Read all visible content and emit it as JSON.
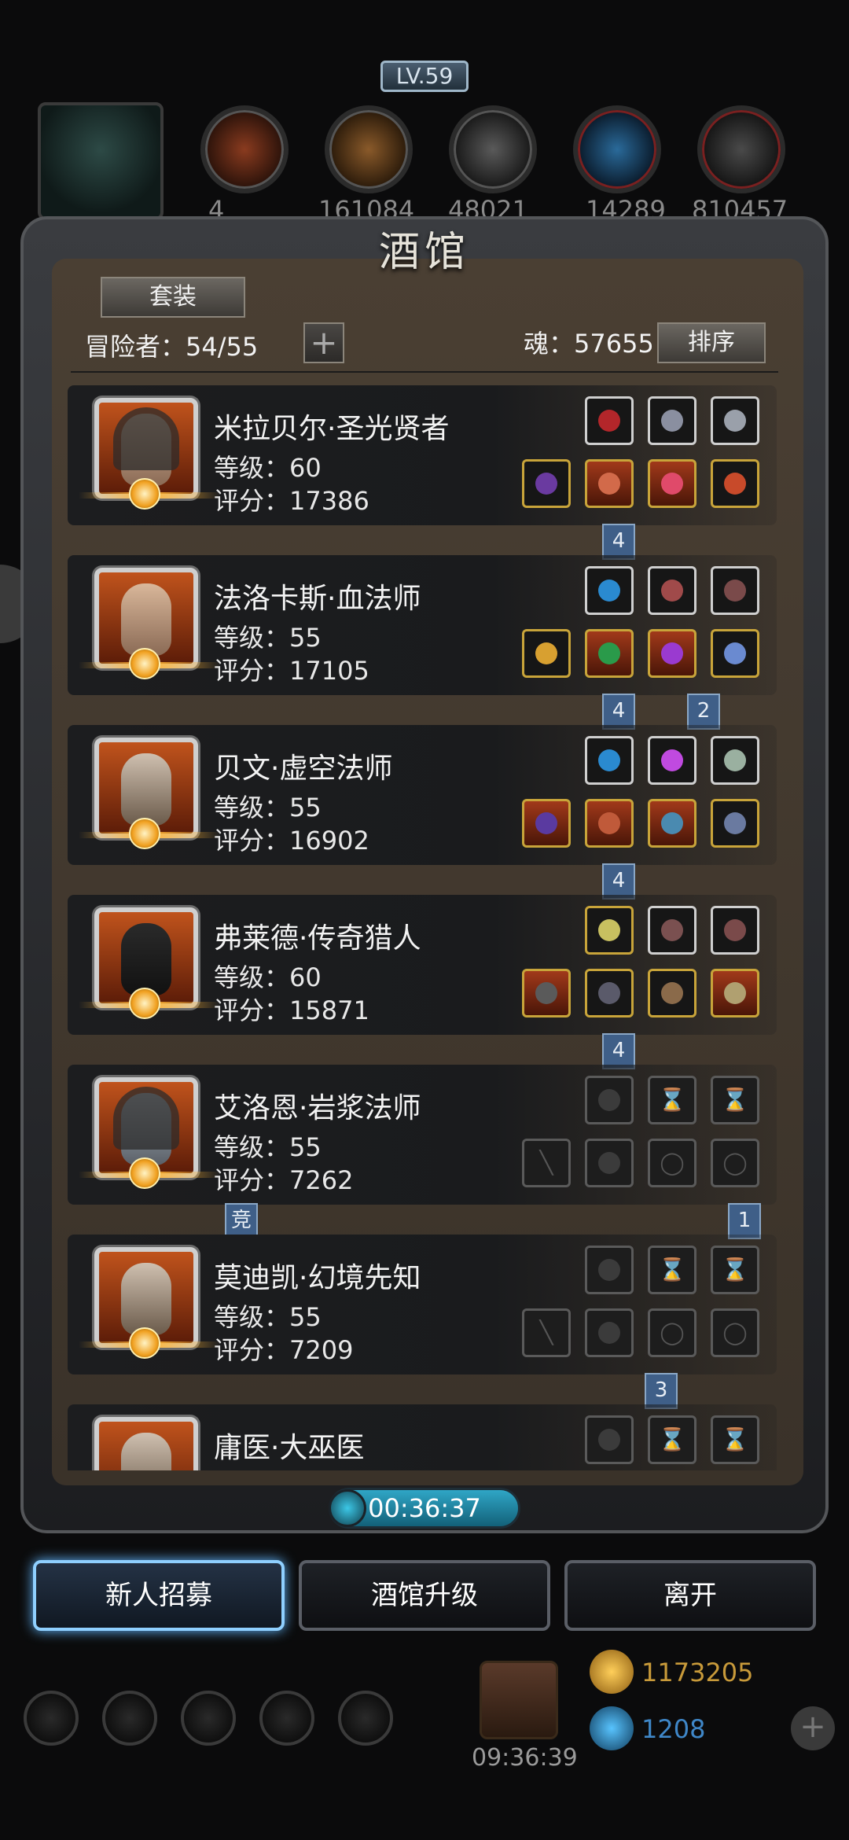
{
  "resources": {
    "values": [
      "4",
      "161084",
      "48021",
      "14289",
      "810457"
    ]
  },
  "tavern": {
    "title": "酒馆",
    "level": "LV.59",
    "set_button": "套装",
    "adventurers_label": "冒险者：54/55",
    "plus": "+",
    "soul_label": "魂：57655",
    "sort_button": "排序"
  },
  "heroes": [
    {
      "name": "米拉贝尔·圣光贤者",
      "level": "等级：60",
      "score": "评分：17386"
    },
    {
      "name": "法洛卡斯·血法师",
      "level": "等级：55",
      "score": "评分：17105"
    },
    {
      "name": "贝文·虚空法师",
      "level": "等级：55",
      "score": "评分：16902"
    },
    {
      "name": "弗莱德·传奇猎人",
      "level": "等级：60",
      "score": "评分：15871"
    },
    {
      "name": "艾洛恩·岩浆法师",
      "level": "等级：55",
      "score": "评分：7262"
    },
    {
      "name": "莫迪凯·幻境先知",
      "level": "等级：55",
      "score": "评分：7209"
    },
    {
      "name": "庸医·大巫医",
      "level": "",
      "score": ""
    }
  ],
  "tags": {
    "t1": "4",
    "t2a": "4",
    "t2b": "2",
    "t3": "4",
    "t4": "4",
    "t5a": "竞",
    "t5b": "1",
    "t6": "3"
  },
  "timer": "00:36:37",
  "buttons": {
    "recruit": "新人招募",
    "upgrade": "酒馆升级",
    "leave": "离开"
  },
  "bottom": {
    "gift_time": "09:36:39",
    "gold": "1173205",
    "gems": "1208",
    "add": "+"
  }
}
